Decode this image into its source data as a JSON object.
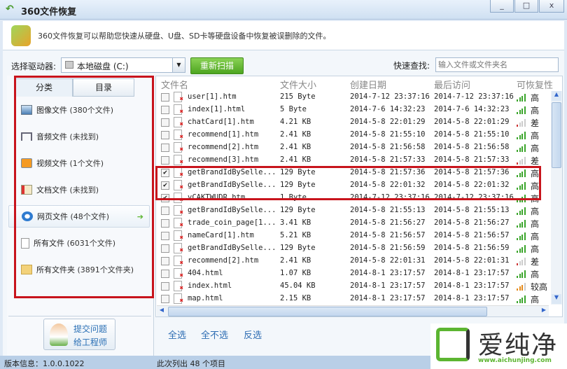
{
  "window": {
    "title": "360文件恢复",
    "minimize": "_",
    "maximize": "□",
    "close": "x"
  },
  "banner": {
    "text": "360文件恢复可以帮助您快速从硬盘、U盘、SD卡等硬盘设备中恢复被误删除的文件。"
  },
  "toolbar": {
    "drive_label": "选择驱动器:",
    "drive_value": "本地磁盘 (C:)",
    "rescan": "重新扫描",
    "search_label": "快速查找:",
    "search_placeholder": "输入文件或文件夹名"
  },
  "left": {
    "tabs": [
      "分类",
      "目录"
    ],
    "categories": [
      {
        "name": "图像文件",
        "count": "(380个文件)",
        "icon": "image-icon"
      },
      {
        "name": "音频文件",
        "count": "(未找到)",
        "icon": "music-icon"
      },
      {
        "name": "视频文件",
        "count": "(1个文件)",
        "icon": "video-icon"
      },
      {
        "name": "文档文件",
        "count": "(未找到)",
        "icon": "document-icon"
      },
      {
        "name": "网页文件",
        "count": "(48个文件)",
        "icon": "web-icon",
        "selected": true
      },
      {
        "name": "所有文件",
        "count": "(6031个文件)",
        "icon": "file-icon"
      },
      {
        "name": "所有文件夹",
        "count": "(3891个文件夹)",
        "icon": "folder-icon"
      }
    ],
    "help_line1": "提交问题",
    "help_line2": "给工程师"
  },
  "list": {
    "columns": [
      "文件名",
      "文件大小",
      "创建日期",
      "最后访问",
      "可恢复性"
    ],
    "rows": [
      {
        "checked": false,
        "name": "user[1].htm",
        "size": "215 Byte",
        "created": "2014-7-12 23:37:16",
        "accessed": "2014-7-12 23:37:16",
        "rec": "高",
        "level": 4
      },
      {
        "checked": false,
        "name": "index[1].html",
        "size": "5 Byte",
        "created": "2014-7-6 14:32:23",
        "accessed": "2014-7-6 14:32:23",
        "rec": "高",
        "level": 4
      },
      {
        "checked": false,
        "name": "chatCard[1].htm",
        "size": "4.21 KB",
        "created": "2014-5-8 22:01:29",
        "accessed": "2014-5-8 22:01:29",
        "rec": "差",
        "level": 1
      },
      {
        "checked": false,
        "name": "recommend[1].htm",
        "size": "2.41 KB",
        "created": "2014-5-8 21:55:10",
        "accessed": "2014-5-8 21:55:10",
        "rec": "高",
        "level": 4
      },
      {
        "checked": false,
        "name": "recommend[2].htm",
        "size": "2.41 KB",
        "created": "2014-5-8 21:56:58",
        "accessed": "2014-5-8 21:56:58",
        "rec": "高",
        "level": 4
      },
      {
        "checked": false,
        "name": "recommend[3].htm",
        "size": "2.41 KB",
        "created": "2014-5-8 21:57:33",
        "accessed": "2014-5-8 21:57:33",
        "rec": "差",
        "level": 1
      },
      {
        "checked": true,
        "name": "getBrandIdBySelle...",
        "size": "129 Byte",
        "created": "2014-5-8 21:57:36",
        "accessed": "2014-5-8 21:57:36",
        "rec": "高",
        "level": 4
      },
      {
        "checked": true,
        "name": "getBrandIdBySelle...",
        "size": "129 Byte",
        "created": "2014-5-8 22:01:32",
        "accessed": "2014-5-8 22:01:32",
        "rec": "高",
        "level": 4
      },
      {
        "checked": true,
        "name": "vCAKTWUDR.htm",
        "size": "1 Byte",
        "created": "2014-7-12 23:37:16",
        "accessed": "2014-7-12 23:37:16",
        "rec": "高",
        "level": 4
      },
      {
        "checked": false,
        "name": "getBrandIdBySelle...",
        "size": "129 Byte",
        "created": "2014-5-8 21:55:13",
        "accessed": "2014-5-8 21:55:13",
        "rec": "高",
        "level": 4
      },
      {
        "checked": false,
        "name": "trade_coin_page[1...",
        "size": "3.41 KB",
        "created": "2014-5-8 21:56:27",
        "accessed": "2014-5-8 21:56:27",
        "rec": "高",
        "level": 4
      },
      {
        "checked": false,
        "name": "nameCard[1].htm",
        "size": "5.21 KB",
        "created": "2014-5-8 21:56:57",
        "accessed": "2014-5-8 21:56:57",
        "rec": "高",
        "level": 4
      },
      {
        "checked": false,
        "name": "getBrandIdBySelle...",
        "size": "129 Byte",
        "created": "2014-5-8 21:56:59",
        "accessed": "2014-5-8 21:56:59",
        "rec": "高",
        "level": 4
      },
      {
        "checked": false,
        "name": "recommend[2].htm",
        "size": "2.41 KB",
        "created": "2014-5-8 22:01:31",
        "accessed": "2014-5-8 22:01:31",
        "rec": "差",
        "level": 1
      },
      {
        "checked": false,
        "name": "404.html",
        "size": "1.07 KB",
        "created": "2014-8-1 23:17:57",
        "accessed": "2014-8-1 23:17:57",
        "rec": "高",
        "level": 4
      },
      {
        "checked": false,
        "name": "index.html",
        "size": "45.04 KB",
        "created": "2014-8-1 23:17:57",
        "accessed": "2014-8-1 23:17:57",
        "rec": "较高",
        "level": 3
      },
      {
        "checked": false,
        "name": "map.html",
        "size": "2.15 KB",
        "created": "2014-8-1 23:17:57",
        "accessed": "2014-8-1 23:17:57",
        "rec": "高",
        "level": 4
      }
    ],
    "select_all": "全选",
    "select_none": "全不选",
    "invert": "反选"
  },
  "status": {
    "version": "版本信息：1.0.0.1022",
    "count": "此次列出 48 个项目"
  },
  "watermark": {
    "brand": "爱纯净",
    "url": "www.aichunjing.com"
  },
  "colors": {
    "accent": "#4da520",
    "highlight": "#c8141c",
    "link": "#2e6db3"
  }
}
